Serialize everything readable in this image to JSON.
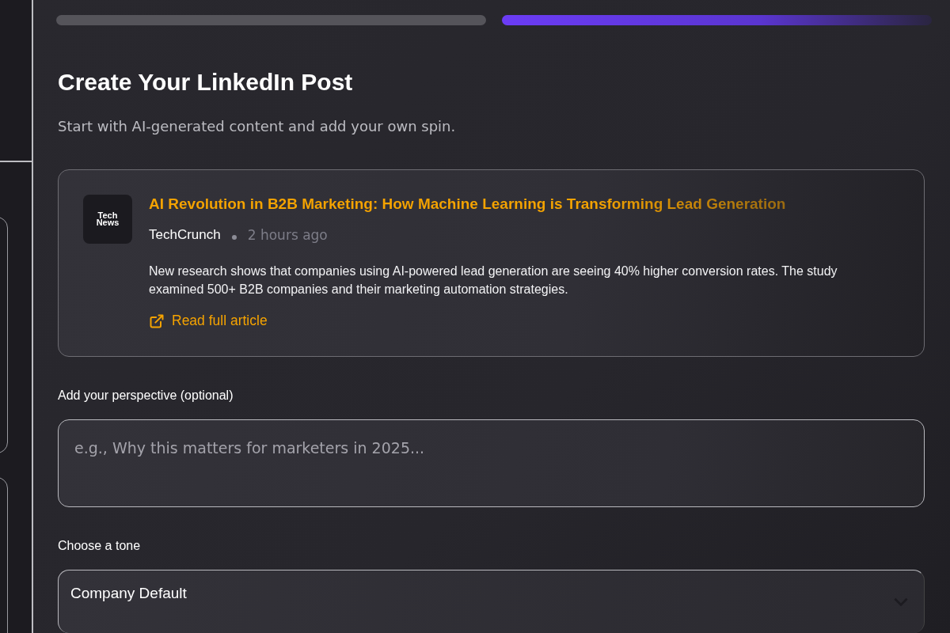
{
  "steps": [
    {
      "selected": false
    },
    {
      "selected": true
    }
  ],
  "title": "Create Your LinkedIn Post",
  "subtitle": "Start with AI-generated content and add your own spin.",
  "article": {
    "logo_text": "Tech News",
    "headline": "AI Revolution in B2B Marketing: How Machine Learning is Transforming Lead Generation",
    "source": "TechCrunch",
    "time": "2 hours ago",
    "summary": "New research shows that companies using AI-powered lead generation are seeing 40% higher conversion rates. The study examined 500+ B2B companies and their marketing automation strategies.",
    "link": "Read full article"
  },
  "perspective": {
    "label": "Add your perspective (optional)",
    "placeholder": "e.g., Why this matters for marketers in 2025..."
  },
  "tone": {
    "label": "Choose a tone",
    "value": "Company Default"
  }
}
